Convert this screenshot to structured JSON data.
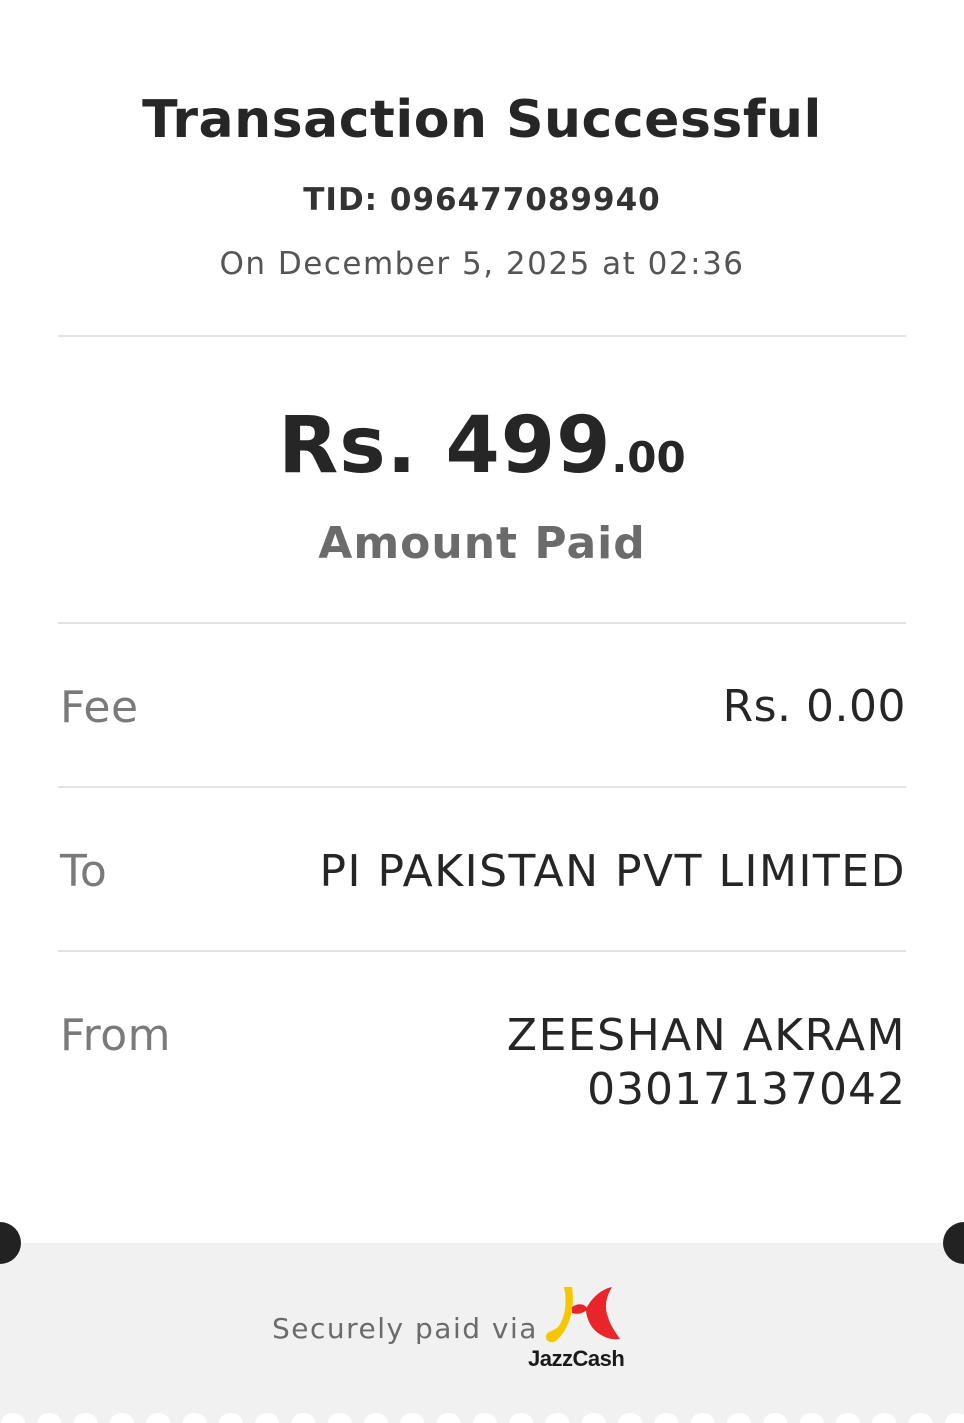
{
  "header": {
    "title": "Transaction Successful",
    "tid": "TID: 096477089940",
    "datetime": "On December 5, 2025 at 02:36"
  },
  "amount": {
    "main": "Rs. 499",
    "decimals": ".00",
    "label": "Amount Paid"
  },
  "details": {
    "fee_label": "Fee",
    "fee_value": "Rs. 0.00",
    "to_label": "To",
    "to_value": "PI PAKISTAN PVT LIMITED",
    "from_label": "From",
    "from_name": "ZEESHAN AKRAM",
    "from_number": "03017137042"
  },
  "footer": {
    "secure_text": "Securely paid via",
    "brand_text": "JazzCash",
    "brand_icon": "jazzcash-logo-icon"
  },
  "colors": {
    "text_dark": "#262626",
    "text_muted": "#7a7a7a",
    "divider": "#e3e3e3",
    "footer_bg": "#f1f1f1",
    "brand_yellow": "#f7c600",
    "brand_red": "#e8262a"
  }
}
